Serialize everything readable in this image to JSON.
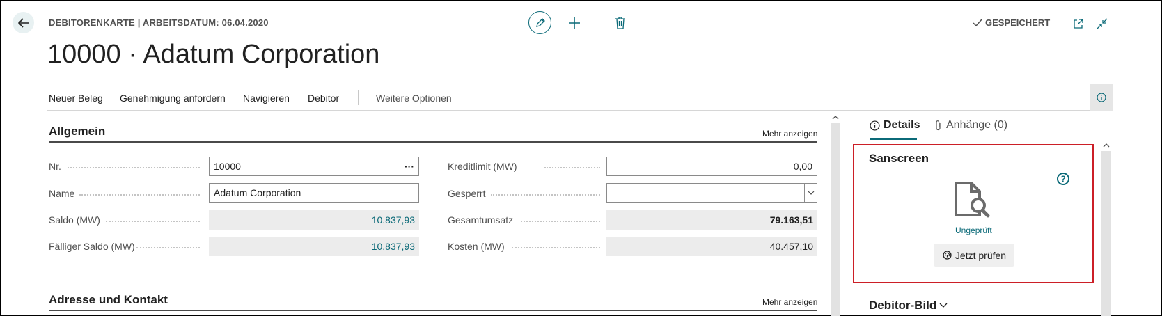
{
  "header": {
    "caption": "DEBITORENKARTE | ARBEITSDATUM: 06.04.2020",
    "title": "10000 · Adatum Corporation",
    "saved_label": "GESPEICHERT"
  },
  "action_bar": {
    "items": [
      "Neuer Beleg",
      "Genehmigung anfordern",
      "Navigieren",
      "Debitor"
    ],
    "more_options": "Weitere Optionen"
  },
  "general": {
    "title": "Allgemein",
    "more_label": "Mehr anzeigen",
    "left_fields": [
      {
        "label": "Nr.",
        "value": "10000"
      },
      {
        "label": "Name",
        "value": "Adatum Corporation"
      },
      {
        "label": "Saldo (MW)",
        "value": "10.837,93"
      },
      {
        "label": "Fälliger Saldo (MW)",
        "value": "10.837,93"
      }
    ],
    "right_fields": [
      {
        "label": "Kreditlimit (MW)",
        "value": "0,00"
      },
      {
        "label": "Gesperrt",
        "value": ""
      },
      {
        "label": "Gesamtumsatz",
        "value": "79.163,51"
      },
      {
        "label": "Kosten (MW)",
        "value": "40.457,10"
      }
    ],
    "lookup_ellipsis": "···"
  },
  "address": {
    "title": "Adresse und Kontakt",
    "more_label": "Mehr anzeigen"
  },
  "factbox": {
    "tabs": [
      {
        "label": "Details",
        "icon": "info-icon"
      },
      {
        "label": "Anhänge (0)",
        "icon": "paperclip-icon"
      }
    ],
    "sanscreen": {
      "title": "Sanscreen",
      "status": "Ungeprüft",
      "button_label": "Jetzt prüfen",
      "help_glyph": "?"
    },
    "debitor_bild": "Debitor-Bild"
  },
  "colors": {
    "accent": "#0b6a78",
    "highlight_border": "#cc1f27",
    "readonly_bg": "#ececec"
  }
}
